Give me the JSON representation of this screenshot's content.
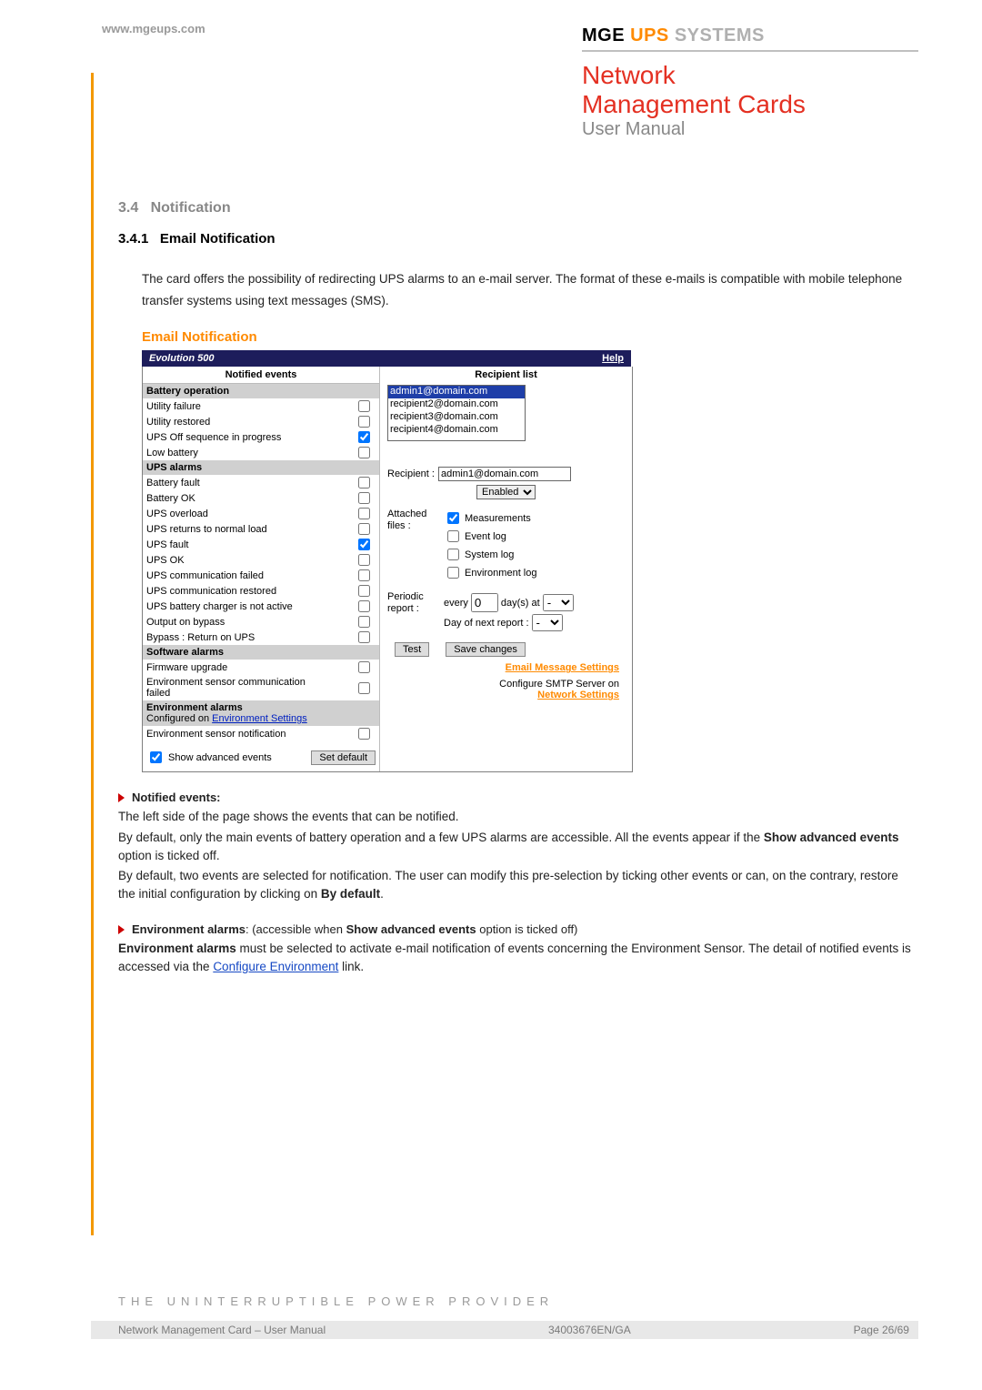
{
  "header": {
    "top_link": "www.mgeups.com",
    "brand_mge": "MGE",
    "brand_ups": "UPS",
    "brand_sys": "SYSTEMS",
    "title1": "Network",
    "title2": "Management Cards",
    "subtitle": "User Manual"
  },
  "section": {
    "num": "3.4",
    "name": "Notification",
    "sub_num": "3.4.1",
    "sub_name": "Email Notification",
    "intro": "The card offers the possibility of redirecting UPS alarms to an e-mail server. The format of these e-mails is compatible with mobile telephone transfer systems using text messages (SMS)."
  },
  "panel": {
    "title": "Email Notification",
    "device": "Evolution 500",
    "help": "Help",
    "left_header": "Notified events",
    "right_header": "Recipient list",
    "categories": {
      "battery": "Battery operation",
      "ups": "UPS alarms",
      "soft": "Software alarms",
      "env": "Environment alarms",
      "env_sub_a": "Configured on ",
      "env_sub_b": "Environment Settings"
    },
    "events": {
      "battery": [
        {
          "label": "Utility failure",
          "checked": false
        },
        {
          "label": "Utility restored",
          "checked": false
        },
        {
          "label": "UPS Off sequence in progress",
          "checked": true
        },
        {
          "label": "Low battery",
          "checked": false
        }
      ],
      "ups": [
        {
          "label": "Battery fault",
          "checked": false
        },
        {
          "label": "Battery OK",
          "checked": false
        },
        {
          "label": "UPS overload",
          "checked": false
        },
        {
          "label": "UPS returns to normal load",
          "checked": false
        },
        {
          "label": "UPS fault",
          "checked": true
        },
        {
          "label": "UPS OK",
          "checked": false
        },
        {
          "label": "UPS communication failed",
          "checked": false
        },
        {
          "label": "UPS communication restored",
          "checked": false
        },
        {
          "label": "UPS battery charger is not active",
          "checked": false
        },
        {
          "label": "Output on bypass",
          "checked": false
        },
        {
          "label": "Bypass : Return on UPS",
          "checked": false
        }
      ],
      "soft": [
        {
          "label": "Firmware upgrade",
          "checked": false
        },
        {
          "label": "Environment sensor communication failed",
          "checked": false
        }
      ],
      "env_list": [
        {
          "label": "Environment sensor notification",
          "checked": false
        }
      ]
    },
    "show_advanced_label": "Show advanced events",
    "show_advanced_checked": true,
    "set_default": "Set default",
    "recipients": {
      "selected": "admin1@domain.com",
      "others": [
        "recipient2@domain.com",
        "recipient3@domain.com",
        "recipient4@domain.com"
      ]
    },
    "recipient_label": "Recipient :",
    "recipient_value": "admin1@domain.com",
    "enabled_label": "Enabled",
    "attached_label": "Attached files :",
    "attached": [
      {
        "label": "Measurements",
        "checked": true
      },
      {
        "label": "Event log",
        "checked": false
      },
      {
        "label": "System log",
        "checked": false
      },
      {
        "label": "Environment log",
        "checked": false
      }
    ],
    "periodic_label": "Periodic report :",
    "periodic": {
      "every_a": "every",
      "every_val": "0",
      "every_b": "day(s) at",
      "at_val": "-",
      "next_label": "Day of next report :",
      "next_val": "-"
    },
    "btn_test": "Test",
    "btn_save": "Save changes",
    "link_email_settings": "Email Message Settings",
    "smtp_note": "Configure SMTP Server on",
    "link_network": "Network Settings"
  },
  "body": {
    "b1_title": "Notified events:",
    "b1_p1": "The left side of the page shows the events that can be notified.",
    "b1_p2a": "By default, only the main events of battery operation and a few UPS alarms are accessible. All the events appear if the ",
    "b1_p2b": "Show advanced events",
    "b1_p2c": " option is ticked off.",
    "b1_p3a": "By default, two events are selected for notification. The user can modify this pre-selection by ticking other events or can, on the contrary, restore the initial configuration by clicking on ",
    "b1_p3b": "By default",
    "b1_p3c": ".",
    "b2_title_a": "Environment alarms",
    "b2_title_b": ": (accessible when ",
    "b2_title_c": "Show advanced events",
    "b2_title_d": " option is ticked off)",
    "b2_p1a": "Environment alarms",
    "b2_p1b": " must be selected to activate e-mail notification of events concerning the Environment Sensor. The detail of notified events is accessed via the ",
    "b2_link": "Configure Environment",
    "b2_p1c": " link."
  },
  "footer": {
    "tagline": "THE UNINTERRUPTIBLE POWER PROVIDER",
    "left_a": "Network Management Card",
    "left_b": " – User Manual",
    "center": "34003676EN/GA",
    "right_a": "Page ",
    "right_b": "26/69"
  }
}
